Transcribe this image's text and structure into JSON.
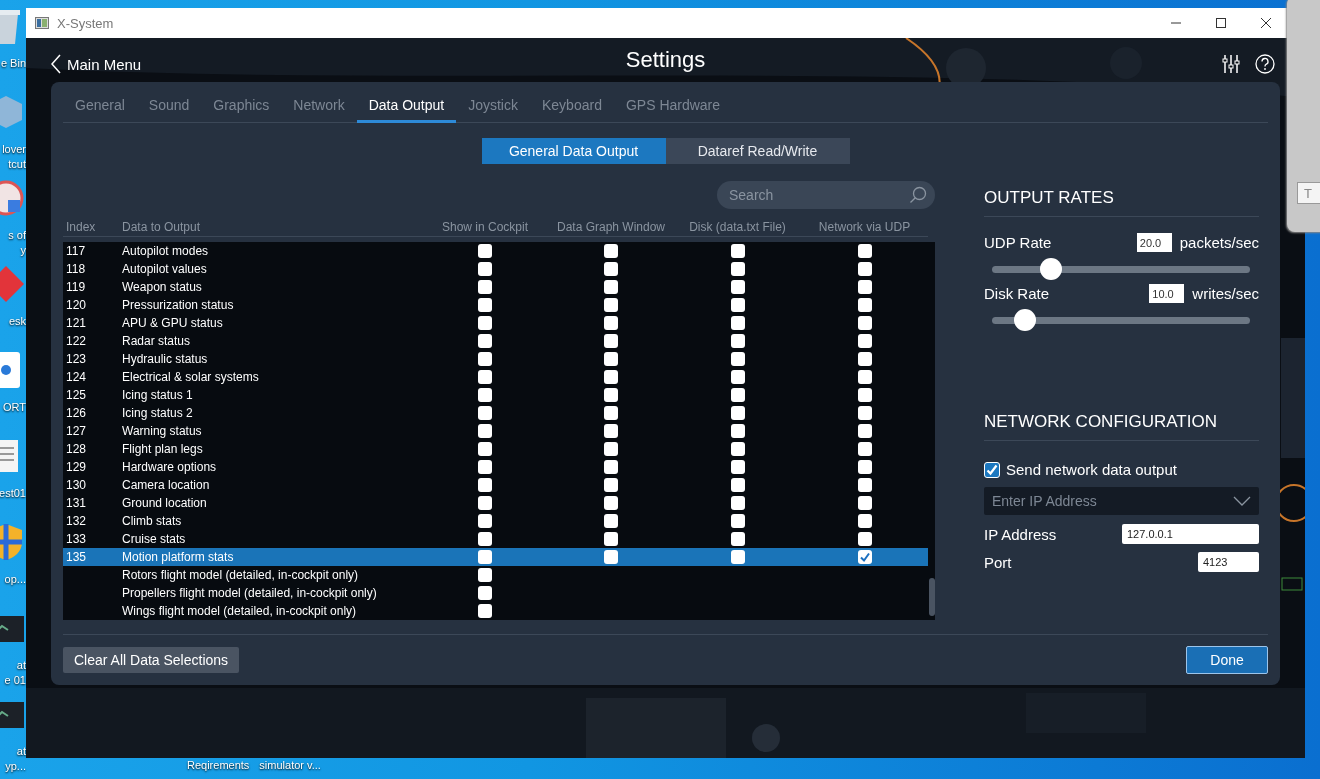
{
  "desktop": {
    "icons": [
      {
        "kind": "bin",
        "lines": [
          "e Bin"
        ]
      },
      {
        "kind": "box",
        "lines": [
          "lover",
          "tcut"
        ]
      },
      {
        "kind": "disc",
        "lines": [
          "s of",
          "y"
        ]
      },
      {
        "kind": "diamond",
        "lines": [
          "esk"
        ]
      },
      {
        "kind": "page",
        "lines": [
          "ORT"
        ]
      },
      {
        "kind": "note",
        "lines": [
          "est01"
        ]
      },
      {
        "kind": "shield",
        "lines": [
          "op..."
        ]
      },
      {
        "kind": "screen",
        "lines": [
          "at",
          "e 01"
        ]
      },
      {
        "kind": "screen",
        "lines": [
          "at",
          "yp..."
        ]
      }
    ],
    "bottom_labels": [
      "Reqirements",
      "simulator v..."
    ],
    "behind_window": {
      "button": "T"
    }
  },
  "window": {
    "title": "X-System"
  },
  "header": {
    "back": "Main Menu",
    "title": "Settings"
  },
  "tabs": [
    {
      "label": "General",
      "selected": false
    },
    {
      "label": "Sound",
      "selected": false
    },
    {
      "label": "Graphics",
      "selected": false
    },
    {
      "label": "Network",
      "selected": false
    },
    {
      "label": "Data Output",
      "selected": true
    },
    {
      "label": "Joystick",
      "selected": false
    },
    {
      "label": "Keyboard",
      "selected": false
    },
    {
      "label": "GPS Hardware",
      "selected": false
    }
  ],
  "subtabs": [
    {
      "label": "General Data Output",
      "selected": true
    },
    {
      "label": "Dataref Read/Write",
      "selected": false
    }
  ],
  "search": {
    "placeholder": "Search"
  },
  "table": {
    "columns": [
      "Index",
      "Data to Output",
      "Show in Cockpit",
      "Data Graph Window",
      "Disk (data.txt File)",
      "Network via UDP"
    ],
    "rows": [
      {
        "index": "117",
        "label": "Autopilot modes",
        "selected": false,
        "checks": [
          false,
          false,
          false,
          false
        ]
      },
      {
        "index": "118",
        "label": "Autopilot values",
        "selected": false,
        "checks": [
          false,
          false,
          false,
          false
        ]
      },
      {
        "index": "119",
        "label": "Weapon status",
        "selected": false,
        "checks": [
          false,
          false,
          false,
          false
        ]
      },
      {
        "index": "120",
        "label": "Pressurization status",
        "selected": false,
        "checks": [
          false,
          false,
          false,
          false
        ]
      },
      {
        "index": "121",
        "label": "APU & GPU status",
        "selected": false,
        "checks": [
          false,
          false,
          false,
          false
        ]
      },
      {
        "index": "122",
        "label": "Radar status",
        "selected": false,
        "checks": [
          false,
          false,
          false,
          false
        ]
      },
      {
        "index": "123",
        "label": "Hydraulic status",
        "selected": false,
        "checks": [
          false,
          false,
          false,
          false
        ]
      },
      {
        "index": "124",
        "label": "Electrical & solar systems",
        "selected": false,
        "checks": [
          false,
          false,
          false,
          false
        ]
      },
      {
        "index": "125",
        "label": "Icing status 1",
        "selected": false,
        "checks": [
          false,
          false,
          false,
          false
        ]
      },
      {
        "index": "126",
        "label": "Icing status 2",
        "selected": false,
        "checks": [
          false,
          false,
          false,
          false
        ]
      },
      {
        "index": "127",
        "label": "Warning status",
        "selected": false,
        "checks": [
          false,
          false,
          false,
          false
        ]
      },
      {
        "index": "128",
        "label": "Flight plan legs",
        "selected": false,
        "checks": [
          false,
          false,
          false,
          false
        ]
      },
      {
        "index": "129",
        "label": "Hardware options",
        "selected": false,
        "checks": [
          false,
          false,
          false,
          false
        ]
      },
      {
        "index": "130",
        "label": "Camera location",
        "selected": false,
        "checks": [
          false,
          false,
          false,
          false
        ]
      },
      {
        "index": "131",
        "label": "Ground location",
        "selected": false,
        "checks": [
          false,
          false,
          false,
          false
        ]
      },
      {
        "index": "132",
        "label": "Climb stats",
        "selected": false,
        "checks": [
          false,
          false,
          false,
          false
        ]
      },
      {
        "index": "133",
        "label": "Cruise stats",
        "selected": false,
        "checks": [
          false,
          false,
          false,
          false
        ]
      },
      {
        "index": "135",
        "label": "Motion platform stats",
        "selected": true,
        "checks": [
          false,
          false,
          false,
          true
        ]
      },
      {
        "label": "Rotors flight model (detailed, in-cockpit only)",
        "selected": false,
        "checks": [
          false
        ]
      },
      {
        "label": "Propellers flight model (detailed, in-cockpit only)",
        "selected": false,
        "checks": [
          false
        ]
      },
      {
        "label": "Wings flight model (detailed, in-cockpit only)",
        "selected": false,
        "checks": [
          false
        ]
      }
    ]
  },
  "clear_button": "Clear All Data Selections",
  "output_rates": {
    "title": "OUTPUT RATES",
    "rates": [
      {
        "label": "UDP Rate",
        "value": "20.0",
        "unit": "packets/sec",
        "level": 0.2
      },
      {
        "label": "Disk Rate",
        "value": "10.0",
        "unit": "writes/sec",
        "level": 0.1
      }
    ]
  },
  "network": {
    "title": "NETWORK CONFIGURATION",
    "send": {
      "label": "Send network data output",
      "checked": true
    },
    "ip_dropdown": {
      "placeholder": "Enter IP Address"
    },
    "fields": [
      {
        "label": "IP Address",
        "value": "127.0.0.1",
        "kind": "wide"
      },
      {
        "label": "Port",
        "value": "4123",
        "kind": "narrow"
      }
    ]
  },
  "done_button": "Done"
}
